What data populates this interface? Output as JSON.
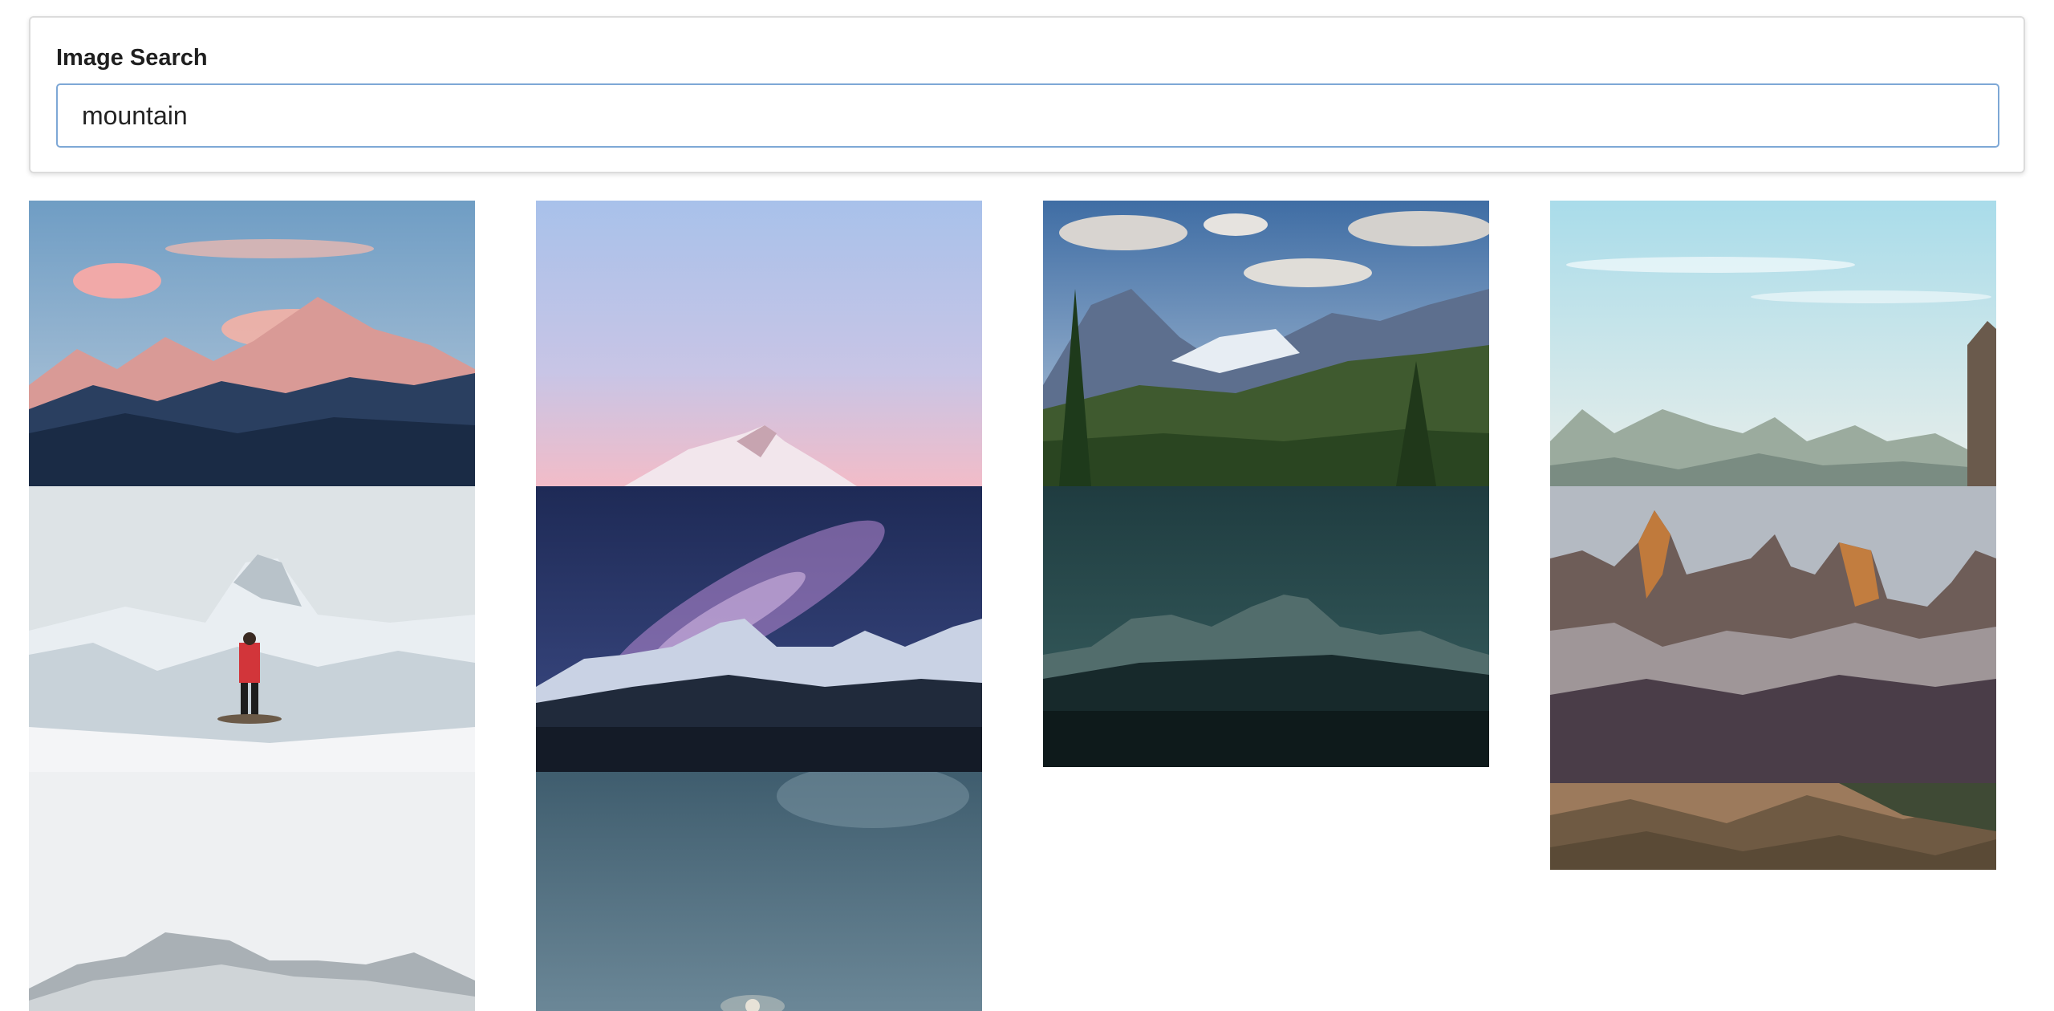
{
  "search": {
    "title": "Image Search",
    "query": "mountain"
  },
  "results": [
    {
      "name": "alpenglow-peaks-image"
    },
    {
      "name": "pink-summit-image"
    },
    {
      "name": "green-valley-mountains-image"
    },
    {
      "name": "hazy-ridges-image"
    },
    {
      "name": "hiker-matterhorn-image"
    },
    {
      "name": "milky-way-peaks-image"
    },
    {
      "name": "teal-dusk-range-image"
    },
    {
      "name": "torres-del-paine-image"
    },
    {
      "name": "snowy-ridge-image"
    },
    {
      "name": "moonrise-sky-image"
    }
  ]
}
